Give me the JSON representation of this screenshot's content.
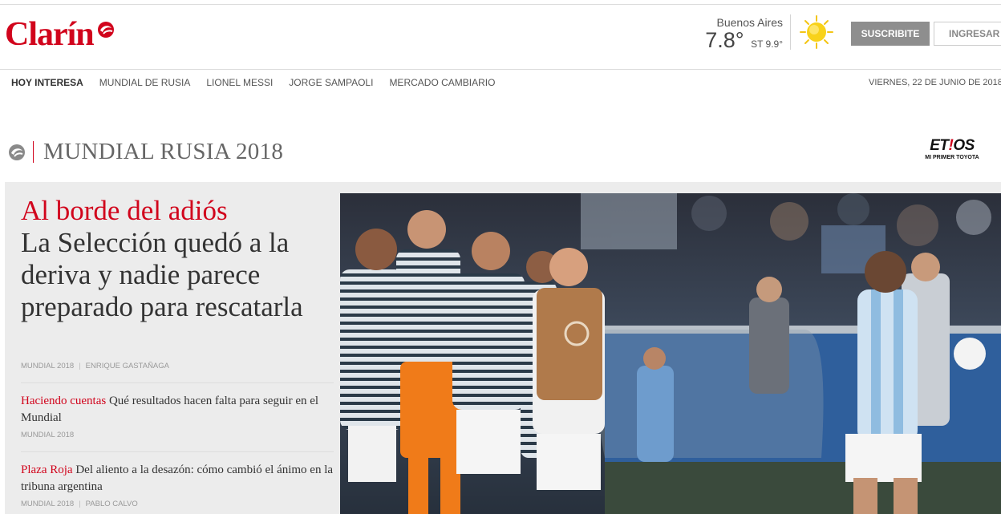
{
  "brand": {
    "logo": "Clarín"
  },
  "weather": {
    "city": "Buenos Aires",
    "temp": "7.8°",
    "st": "ST 9.9°",
    "icon": "sun-icon"
  },
  "actions": {
    "subscribe": "SUSCRIBITE",
    "login": "INGRESAR"
  },
  "nav": {
    "items": [
      "HOY INTERESA",
      "MUNDIAL DE RUSIA",
      "LIONEL MESSI",
      "JORGE SAMPAOLI",
      "MERCADO CAMBIARIO"
    ],
    "date": "VIERNES, 22 DE JUNIO DE 2018"
  },
  "section": {
    "title": "MUNDIAL RUSIA 2018",
    "sponsor_name_a": "ET",
    "sponsor_name_b": "!",
    "sponsor_name_c": "OS",
    "sponsor_tag": "MI PRIMER TOYOTA"
  },
  "lead": {
    "kicker": "Al borde del adiós",
    "title": "La Selección quedó a la deriva y nadie parece preparado para rescatarla",
    "section": "MUNDIAL 2018",
    "author": "ENRIQUE GASTAÑAGA"
  },
  "related": [
    {
      "kicker": "Haciendo cuentas",
      "title": "Qué resultados hacen falta para seguir en el Mundial",
      "section": "MUNDIAL 2018",
      "author": ""
    },
    {
      "kicker": "Plaza Roja",
      "title": "Del aliento a la desazón: cómo cambió el ánimo en la tribuna argentina",
      "section": "MUNDIAL 2018",
      "author": "PABLO CALVO"
    }
  ],
  "colors": {
    "brand_red": "#d1041c",
    "button_gray": "#8e8e8e",
    "panel_bg": "#ececec"
  }
}
